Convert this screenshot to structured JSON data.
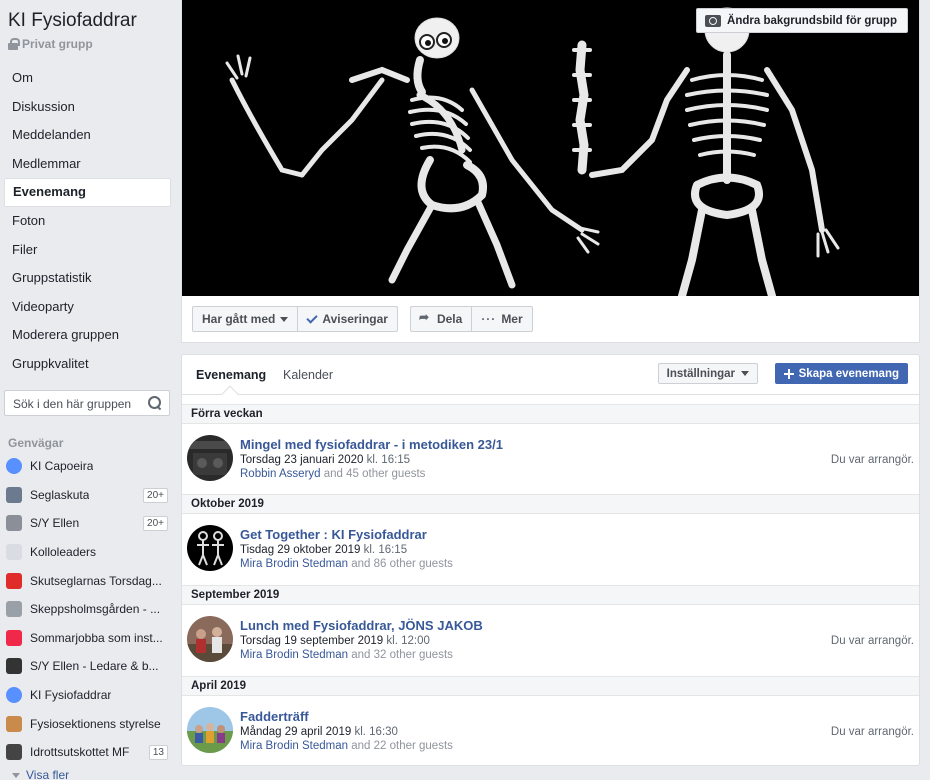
{
  "group": {
    "title": "KI Fysiofaddrar",
    "privacy": "Privat grupp"
  },
  "nav": [
    {
      "label": "Om",
      "active": false
    },
    {
      "label": "Diskussion",
      "active": false
    },
    {
      "label": "Meddelanden",
      "active": false
    },
    {
      "label": "Medlemmar",
      "active": false
    },
    {
      "label": "Evenemang",
      "active": true
    },
    {
      "label": "Foton",
      "active": false
    },
    {
      "label": "Filer",
      "active": false
    },
    {
      "label": "Gruppstatistik",
      "active": false
    },
    {
      "label": "Videoparty",
      "active": false
    },
    {
      "label": "Moderera gruppen",
      "active": false
    },
    {
      "label": "Gruppkvalitet",
      "active": false
    }
  ],
  "search": {
    "placeholder": "Sök i den här gruppen"
  },
  "shortcuts": {
    "title": "Genvägar",
    "items": [
      {
        "label": "KI Capoeira",
        "badge": "",
        "icon": "group-icon",
        "color": "#5890ff"
      },
      {
        "label": "Seglaskuta",
        "badge": "20+",
        "icon": "boat-photo-icon",
        "color": "#6b7a8f"
      },
      {
        "label": "S/Y Ellen",
        "badge": "20+",
        "icon": "ship-photo-icon",
        "color": "#8a8f98"
      },
      {
        "label": "Kolloleaders",
        "badge": "",
        "icon": "kollo-logo-icon",
        "color": "#d9dde3"
      },
      {
        "label": "Skutseglarnas Torsdag...",
        "badge": "",
        "icon": "red-cup-icon",
        "color": "#e02b2b"
      },
      {
        "label": "Skeppsholmsgården - ...",
        "badge": "",
        "icon": "eye-logo-icon",
        "color": "#9aa0a8"
      },
      {
        "label": "Sommarjobba som inst...",
        "badge": "",
        "icon": "calendar-icon",
        "color": "#f02849"
      },
      {
        "label": "S/Y Ellen - Ledare & b...",
        "badge": "",
        "icon": "skull-icon",
        "color": "#333333"
      },
      {
        "label": "KI Fysiofaddrar",
        "badge": "",
        "icon": "group-icon",
        "color": "#5890ff"
      },
      {
        "label": "Fysiosektionens styrelse",
        "badge": "",
        "icon": "gavel-icon",
        "color": "#c98a4b"
      },
      {
        "label": "Idrottsutskottet MF",
        "badge": "13",
        "icon": "team-photo-icon",
        "color": "#444444"
      }
    ],
    "show_more": "Visa fler"
  },
  "cover": {
    "change_label": "Ändra bakgrundsbild för grupp"
  },
  "actions": {
    "joined": "Har gått med",
    "notifications": "Aviseringar",
    "share": "Dela",
    "more": "Mer"
  },
  "events": {
    "tabs": [
      "Evenemang",
      "Kalender"
    ],
    "settings_label": "Inställningar",
    "create_label": "Skapa evenemang",
    "sections": [
      {
        "header": "Förra veckan",
        "events": [
          {
            "title": "Mingel med fysiofaddrar - i metodiken 23/1",
            "date": "Torsdag 23 januari 2020",
            "time": "kl. 16:15",
            "host": "Robbin Asseryd",
            "guests": "and 45 other guests",
            "role": "Du var arrangör."
          }
        ]
      },
      {
        "header": "Oktober 2019",
        "events": [
          {
            "title": "Get Together : KI Fysiofaddrar",
            "date": "Tisdag 29 oktober 2019",
            "time": "kl. 16:15",
            "host": "Mira Brodin Stedman",
            "guests": "and 86 other guests",
            "role": ""
          }
        ]
      },
      {
        "header": "September 2019",
        "events": [
          {
            "title": "Lunch med Fysiofaddrar, JÖNS JAKOB",
            "date": "Torsdag 19 september 2019",
            "time": "kl. 12:00",
            "host": "Mira Brodin Stedman",
            "guests": "and 32 other guests",
            "role": "Du var arrangör."
          }
        ]
      },
      {
        "header": "April 2019",
        "events": [
          {
            "title": "Fadderträff",
            "date": "Måndag 29 april 2019",
            "time": "kl. 16:30",
            "host": "Mira Brodin Stedman",
            "guests": "and 22 other guests",
            "role": "Du var arrangör."
          }
        ]
      }
    ]
  }
}
